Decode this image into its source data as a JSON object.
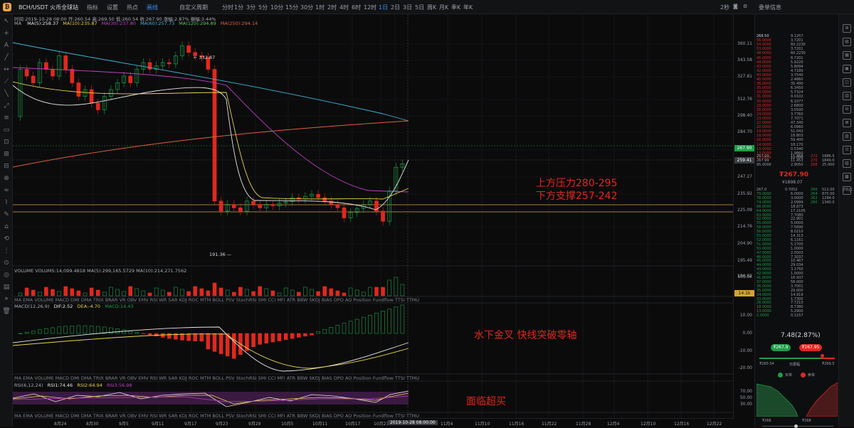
{
  "topbar": {
    "symbol": "BCH/USDT 火币全球站",
    "tools": [
      "指标",
      "设置",
      "热点",
      "画线",
      "自定义周期"
    ],
    "timeframes": [
      "分时",
      "1分",
      "3分",
      "5分",
      "10分",
      "15分",
      "30分",
      "1时",
      "2时",
      "4时",
      "6时",
      "12时",
      "1日",
      "2日",
      "3日",
      "5日",
      "周K",
      "月K",
      "季K",
      "年K"
    ],
    "active_timeframe": "1日",
    "zoom": "2秒",
    "panel_title": "委单信息"
  },
  "ohlc": "时间:2019-10-28 08:00  开:260.54  高:269.50  低:260.54  收:267.90  涨幅:2.87%  振幅:3.44%",
  "ma_legend": {
    "label": "MA",
    "items": [
      {
        "text": "MA(5):258.37",
        "color": "#e8e8e8"
      },
      {
        "text": "MA(10):235.87",
        "color": "#e8d44d"
      },
      {
        "text": "MA(30):237.80",
        "color": "#c040c0"
      },
      {
        "text": "MA(60):257.73",
        "color": "#40b8d8"
      },
      {
        "text": "MA(120):294.89",
        "color": "#60c860"
      },
      {
        "text": "MA(250):294.14",
        "color": "#e06040"
      }
    ]
  },
  "volume_legend": "VOLUME   VOLUMS:14,099.4818  MA(5):299,165.5729  MA(10):214,271.7562",
  "macd_legend": {
    "title": "MACD(12,26,9)",
    "dif": "DIF:2.52",
    "dea": "DEA:-4.70",
    "macd": "MACD:14.43"
  },
  "rsi_legend": {
    "title": "RSI(6,12,24)",
    "r1": "RSI1:74.46",
    "r2": "RSI2:64.94",
    "r3": "RSI3:56.98"
  },
  "indicator_tabs": "MA  EMA  VOLUME  MACD  DMI  DMA  TRIX  BRAR  VR  OBV  EMV  RSI  WR  SAR  KDJ  ROC  MTM  BOLL  PSV  StochRSI  SMI  CCI  MFI  ATR  BBW  SKDJ  BIAS  DPO  AO  Position  Fundflow  TTSI  TTMU",
  "price_marks": {
    "high": "← 332.87",
    "low": "191.36 —"
  },
  "price_axis": [
    "360.11",
    "343.58",
    "327.81",
    "312.76",
    "298.40",
    "284.70",
    "271.64",
    "259.41",
    "247.27",
    "235.92",
    "225.09",
    "214.76",
    "204.90",
    "195.49",
    "186.52"
  ],
  "current_price": "267.90",
  "crosshair_price": "259.41",
  "volume_axis": [
    "500.0k",
    "14.1k"
  ],
  "macd_axis": [
    "10.00",
    "0.00",
    "-10.00",
    "-20.00"
  ],
  "rsi_axis": [
    "70.00",
    "50.00",
    "30.00"
  ],
  "time_labels": [
    "8月24",
    "8月30",
    "9月5",
    "9月11",
    "9月17",
    "9月23",
    "9月29",
    "10月5",
    "10月11",
    "10月17",
    "10月23",
    "2019-10-28 08:00:00",
    "11月4",
    "11月10",
    "11月16",
    "11月22",
    "11月28",
    "12月4",
    "12月10",
    "12月16",
    "12月22"
  ],
  "annotations": {
    "resistance": "上方压力280-295",
    "support": "下方支撑257-242",
    "macd_note": "水下金叉  快线突破零轴",
    "rsi_note": "面临超买"
  },
  "book": {
    "asks_top": [
      [
        "268.50",
        "9.1257"
      ],
      [
        "56.0000",
        "3.7201"
      ],
      [
        "54.0000",
        "60.2230"
      ],
      [
        "53.0000",
        "3.7201"
      ],
      [
        "48.0000",
        "60.2230"
      ],
      [
        "46.0000",
        "8.7201"
      ],
      [
        "44.0000",
        "5.9220"
      ],
      [
        "43.0000",
        "5.8094"
      ],
      [
        "42.0000",
        "4.7180"
      ],
      [
        "43.0000",
        "3.7540"
      ],
      [
        "40.0000",
        "2.4860"
      ],
      [
        "36.0000",
        "35.490"
      ],
      [
        "35.0000",
        "6.3450"
      ],
      [
        "33.0000",
        "5.7324"
      ],
      [
        "31.0000",
        "0.0102"
      ],
      [
        "30.0000",
        "6.1077"
      ],
      [
        "29.0000",
        "2.6800"
      ],
      [
        "26.0000",
        "3.5500"
      ],
      [
        "24.0000",
        "3.7760"
      ],
      [
        "23.0000",
        "7.7071"
      ],
      [
        "22.0000",
        "47.340"
      ],
      [
        "20.0000",
        "6.0960"
      ],
      [
        "19.0000",
        "51.043"
      ],
      [
        "18.0000",
        "18.803"
      ],
      [
        "16.0000",
        "59.400"
      ],
      [
        "14.0000",
        "18.170"
      ],
      [
        "13.0000",
        "0.5340"
      ],
      [
        "13.0000",
        "1.9860"
      ],
      [
        "12.0000",
        "11.000"
      ]
    ],
    "mid_rows": [
      [
        "267.99",
        "11.458",
        "272",
        "1886.5"
      ],
      [
        "267.99",
        "11.453",
        "270",
        "1849.0"
      ],
      [
        "95.0000",
        "2.9050",
        "268",
        "25.000"
      ]
    ],
    "last_price": "₮267.90",
    "last_cny": "¥1898.07",
    "bids_header": [
      "267.0",
      "0.7052",
      "266",
      "512.00"
    ],
    "bids_side": [
      [
        "264",
        "875.00"
      ],
      [
        "262",
        "1294.0"
      ],
      [
        "260",
        "1340.0"
      ]
    ],
    "bids": [
      [
        "79.0000",
        "6.0000"
      ],
      [
        "76.0000",
        "3.0000"
      ],
      [
        "74.0000",
        "2.0999"
      ],
      [
        "66.0000",
        "18.873"
      ],
      [
        "64.0000",
        "17.2105"
      ],
      [
        "63.0000",
        "7.7080"
      ],
      [
        "62.0000",
        "22.901"
      ],
      [
        "55.0000",
        "5.0000"
      ],
      [
        "58.0000",
        "7.5690"
      ],
      [
        "56.0000",
        "8.0210"
      ],
      [
        "55.0000",
        "14.313"
      ],
      [
        "52.0000",
        "6.1161"
      ],
      [
        "51.0000",
        "5.1700"
      ],
      [
        "50.0000",
        "1.0000"
      ],
      [
        "47.0000",
        "2.0503"
      ],
      [
        "46.0000",
        "7.3037"
      ],
      [
        "45.0000",
        "10.467"
      ],
      [
        "44.0000",
        "29.034"
      ],
      [
        "43.0000",
        "3.1750"
      ],
      [
        "42.0000",
        "1.0000"
      ],
      [
        "41.0000",
        "16.937"
      ],
      [
        "37.0000",
        "58.000"
      ],
      [
        "36.0000",
        "3.7001"
      ],
      [
        "35.0000",
        "29.000"
      ],
      [
        "34.0000",
        "14.919"
      ],
      [
        "33.0000",
        "1.7300"
      ],
      [
        "26.0000",
        "7.7210"
      ],
      [
        "18.0000",
        "8.7380"
      ],
      [
        "13.0000",
        "5.2900"
      ],
      [
        "2.0000",
        "0.1157"
      ]
    ],
    "change": "7.48(2.87%)",
    "bid_pill": "₮267.9",
    "ask_pill": "₮267.95",
    "range_low": "₮260.54",
    "range_label": "日振幅",
    "range_high": "₮269.5",
    "buy_label": "买单",
    "sell_label": "卖单",
    "depth_left": "₮266",
    "depth_right": "₮268"
  },
  "colors": {
    "up": "#1f9e48",
    "down": "#e0281e",
    "accent": "#3a8ff0",
    "current": "#1f9e48",
    "gold": "#d6a23a"
  }
}
